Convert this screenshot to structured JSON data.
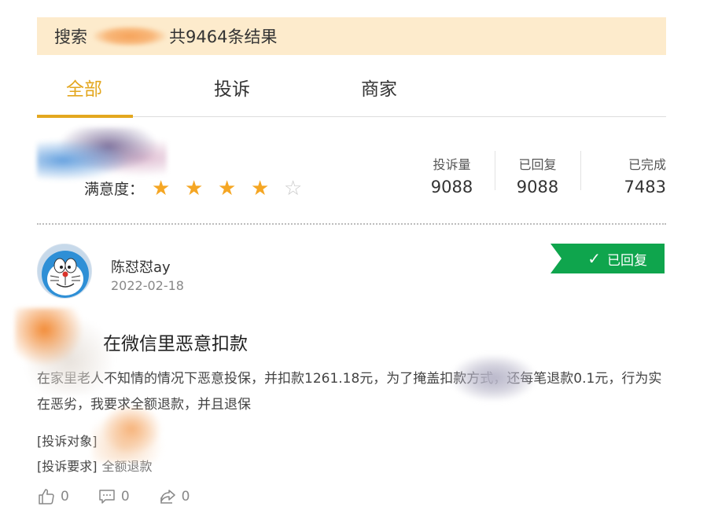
{
  "search": {
    "prefix": "搜索",
    "result_text": "共9464条结果"
  },
  "tabs": [
    {
      "label": "全部",
      "active": true
    },
    {
      "label": "投诉",
      "active": false
    },
    {
      "label": "商家",
      "active": false
    }
  ],
  "merchant": {
    "satisfaction_label": "满意度：",
    "rating": 4,
    "max_rating": 5,
    "stats": [
      {
        "label": "投诉量",
        "value": "9088"
      },
      {
        "label": "已回复",
        "value": "9088"
      },
      {
        "label": "已完成",
        "value": "7483"
      }
    ]
  },
  "complaint": {
    "user_name": "陈怼怼ay",
    "date": "2022-02-18",
    "status_badge": "已回复",
    "title": "在微信里恶意扣款",
    "body": "在家里老人不知情的情况下恶意投保，并扣款1261.18元，为了掩盖扣款方式，还每笔退款0.1元，行为实在恶劣，我要求全额退款，并且退保",
    "target_label": "[投诉对象]",
    "request_label": "[投诉要求]",
    "request_value": "全额退款",
    "likes": "0",
    "comments": "0",
    "shares": "0"
  },
  "colors": {
    "accent": "#e3a71f",
    "search_bg": "#fdebcc",
    "star": "#f5a623",
    "badge": "#0fa54d"
  }
}
